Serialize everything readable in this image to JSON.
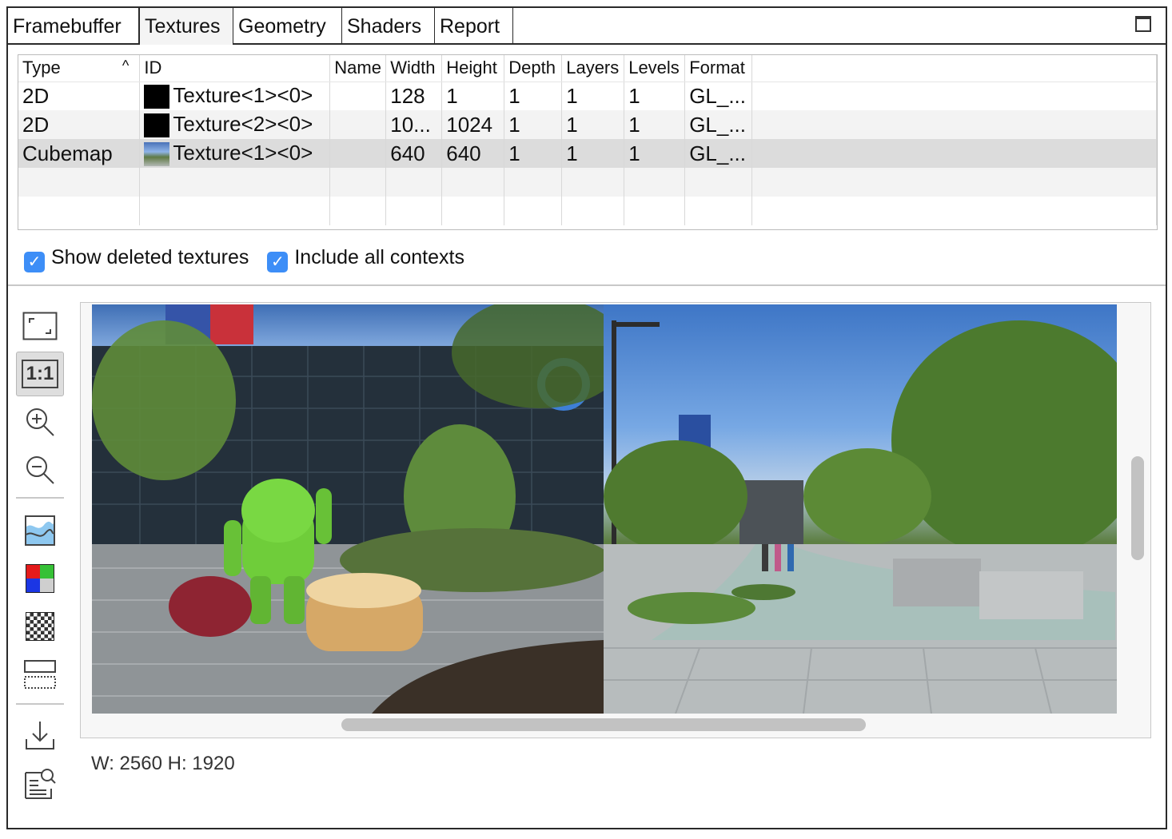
{
  "tabs": [
    "Framebuffer",
    "Textures",
    "Geometry",
    "Shaders",
    "Report"
  ],
  "active_tab": "Textures",
  "table": {
    "columns": [
      "Type",
      "ID",
      "Name",
      "Width",
      "Height",
      "Depth",
      "Layers",
      "Levels",
      "Format"
    ],
    "sort_column": "Type",
    "rows": [
      {
        "type": "2D",
        "id": "Texture<1><0>",
        "name": "",
        "width": "128",
        "height": "1",
        "depth": "1",
        "layers": "1",
        "levels": "1",
        "format": "GL_..."
      },
      {
        "type": "2D",
        "id": "Texture<2><0>",
        "name": "",
        "width": "10...",
        "height": "1024",
        "depth": "1",
        "layers": "1",
        "levels": "1",
        "format": "GL_..."
      },
      {
        "type": "Cubemap",
        "id": "Texture<1><0>",
        "name": "",
        "width": "640",
        "height": "640",
        "depth": "1",
        "layers": "1",
        "levels": "1",
        "format": "GL_..."
      }
    ]
  },
  "options": {
    "show_deleted": {
      "label": "Show deleted textures",
      "checked": true
    },
    "include_contexts": {
      "label": "Include all contexts",
      "checked": true
    }
  },
  "toolbar_icons": [
    "fit-icon",
    "one-to-one-icon",
    "zoom-in-icon",
    "zoom-out-icon",
    "histogram-icon",
    "color-channels-icon",
    "checkerboard-icon",
    "flip-icon",
    "save-icon",
    "inspect-icon"
  ],
  "toolbar_one_to_one_label": "1:1",
  "image_info": "W: 2560 H: 1920",
  "colors": {
    "accent": "#3d8ef7",
    "border": "#2a2a2a",
    "selected_row": "#dcdcdc"
  }
}
